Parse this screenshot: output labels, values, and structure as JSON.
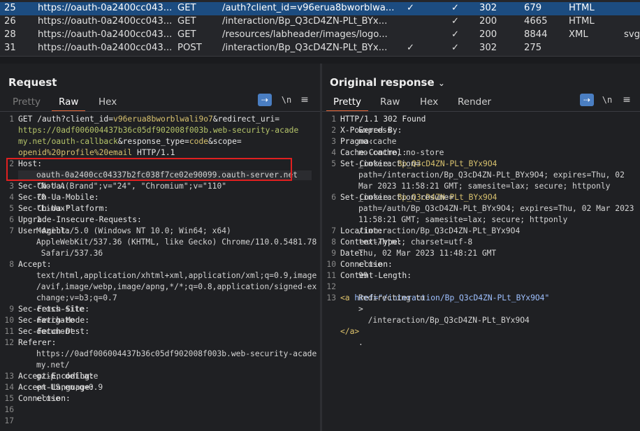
{
  "history": {
    "rows": [
      {
        "num": "25",
        "host": "https://oauth-0a2400cc043...",
        "method": "GET",
        "url": "/auth?client_id=v96erua8bworblwa...",
        "params": "✓",
        "edited": "✓",
        "status": "302",
        "length": "679",
        "mime": "HTML",
        "ext": "",
        "selected": true
      },
      {
        "num": "26",
        "host": "https://oauth-0a2400cc043...",
        "method": "GET",
        "url": "/interaction/Bp_Q3cD4ZN-PLt_BYx...",
        "params": "",
        "edited": "✓",
        "status": "200",
        "length": "4665",
        "mime": "HTML",
        "ext": "",
        "selected": false
      },
      {
        "num": "28",
        "host": "https://oauth-0a2400cc043...",
        "method": "GET",
        "url": "/resources/labheader/images/logo...",
        "params": "",
        "edited": "✓",
        "status": "200",
        "length": "8844",
        "mime": "XML",
        "ext": "svg",
        "selected": false
      },
      {
        "num": "31",
        "host": "https://oauth-0a2400cc043...",
        "method": "POST",
        "url": "/interaction/Bp_Q3cD4ZN-PLt_BYx...",
        "params": "✓",
        "edited": "✓",
        "status": "302",
        "length": "275",
        "mime": "",
        "ext": "",
        "selected": false
      }
    ]
  },
  "request": {
    "title": "Request",
    "tabs": [
      "Pretty",
      "Raw",
      "Hex"
    ],
    "active_tab": "Raw",
    "wrap_icon": "wrap-lines-icon",
    "newline_label": "\\n",
    "menu_icon": "hamburger-menu-icon"
  },
  "response": {
    "title": "Original response",
    "tabs": [
      "Pretty",
      "Raw",
      "Hex",
      "Render"
    ],
    "active_tab": "Pretty",
    "wrap_icon": "wrap-lines-icon",
    "newline_label": "\\n",
    "menu_icon": "hamburger-menu-icon"
  },
  "request_lines": [
    {
      "n": "1",
      "segs": [
        [
          "GET /auth?client_id=",
          "hdr"
        ],
        [
          "v96erua8bworblwali9o7",
          "yel"
        ],
        [
          "&redirect_uri=",
          "hdr"
        ]
      ]
    },
    {
      "n": "",
      "segs": [
        [
          "https://0adf006004437b36c05df902008f003b.web-security-acade",
          "grn"
        ]
      ]
    },
    {
      "n": "",
      "segs": [
        [
          "my.net/oauth-callback",
          "grn"
        ],
        [
          "&response_type=",
          "hdr"
        ],
        [
          "code",
          "yel"
        ],
        [
          "&scope=",
          "hdr"
        ]
      ]
    },
    {
      "n": "",
      "segs": [
        [
          "openid%20profile%20email",
          "yel"
        ],
        [
          " HTTP/1.1",
          "hdr"
        ]
      ]
    },
    {
      "n": "2",
      "segs": [
        [
          "Host:",
          "hdr"
        ]
      ]
    },
    {
      "n": "",
      "segs": [
        [
          "oauth-0a2400cc04337b2fc038f7ce02e90099.oauth-server.net",
          "txt"
        ]
      ]
    },
    {
      "n": "3",
      "segs": [
        [
          "Sec-Ch-Ua: ",
          "hdr"
        ],
        [
          "\"Not A(Brand\";v=\"24\", \"Chromium\";v=\"110\"",
          "txt"
        ]
      ]
    },
    {
      "n": "4",
      "segs": [
        [
          "Sec-Ch-Ua-Mobile: ",
          "hdr"
        ],
        [
          "?0",
          "txt"
        ]
      ]
    },
    {
      "n": "5",
      "segs": [
        [
          "Sec-Ch-Ua-Platform: ",
          "hdr"
        ],
        [
          "\"Linux\"",
          "txt"
        ]
      ]
    },
    {
      "n": "6",
      "segs": [
        [
          "Upgrade-Insecure-Requests: ",
          "hdr"
        ],
        [
          "1",
          "txt"
        ]
      ]
    },
    {
      "n": "7",
      "segs": [
        [
          "User-Agent: ",
          "hdr"
        ],
        [
          "Mozilla/5.0 (Windows NT 10.0; Win64; x64)",
          "txt"
        ]
      ]
    },
    {
      "n": "",
      "segs": [
        [
          "AppleWebKit/537.36 (KHTML, like Gecko) Chrome/110.0.5481.78",
          "txt"
        ]
      ]
    },
    {
      "n": "",
      "segs": [
        [
          " Safari/537.36",
          "txt"
        ]
      ]
    },
    {
      "n": "8",
      "segs": [
        [
          "Accept:",
          "hdr"
        ]
      ]
    },
    {
      "n": "",
      "segs": [
        [
          "text/html,application/xhtml+xml,application/xml;q=0.9,image",
          "txt"
        ]
      ]
    },
    {
      "n": "",
      "segs": [
        [
          "/avif,image/webp,image/apng,*/*;q=0.8,application/signed-ex",
          "txt"
        ]
      ]
    },
    {
      "n": "",
      "segs": [
        [
          "change;v=b3;q=0.7",
          "txt"
        ]
      ]
    },
    {
      "n": "9",
      "segs": [
        [
          "Sec-Fetch-Site: ",
          "hdr"
        ],
        [
          "cross-site",
          "txt"
        ]
      ]
    },
    {
      "n": "10",
      "segs": [
        [
          "Sec-Fetch-Mode: ",
          "hdr"
        ],
        [
          "navigate",
          "txt"
        ]
      ]
    },
    {
      "n": "11",
      "segs": [
        [
          "Sec-Fetch-Dest: ",
          "hdr"
        ],
        [
          "document",
          "txt"
        ]
      ]
    },
    {
      "n": "12",
      "segs": [
        [
          "Referer:",
          "hdr"
        ]
      ]
    },
    {
      "n": "",
      "segs": [
        [
          "https://0adf006004437b36c05df902008f003b.web-security-acade",
          "txt"
        ]
      ]
    },
    {
      "n": "",
      "segs": [
        [
          "my.net/",
          "txt"
        ]
      ]
    },
    {
      "n": "13",
      "segs": [
        [
          "Accept-Encoding: ",
          "hdr"
        ],
        [
          "gzip, deflate",
          "txt"
        ]
      ]
    },
    {
      "n": "14",
      "segs": [
        [
          "Accept-Language: ",
          "hdr"
        ],
        [
          "en-US,en;q=0.9",
          "txt"
        ]
      ]
    },
    {
      "n": "15",
      "segs": [
        [
          "Connection: ",
          "hdr"
        ],
        [
          "close",
          "txt"
        ]
      ]
    },
    {
      "n": "16",
      "segs": []
    },
    {
      "n": "17",
      "segs": []
    }
  ],
  "response_lines": [
    {
      "n": "1",
      "segs": [
        [
          "HTTP/1.1 302 Found",
          "hdr"
        ]
      ]
    },
    {
      "n": "2",
      "segs": [
        [
          "X-Powered-By: ",
          "hdr"
        ],
        [
          "Express",
          "txt"
        ]
      ]
    },
    {
      "n": "3",
      "segs": [
        [
          "Pragma: ",
          "hdr"
        ],
        [
          "no-cache",
          "txt"
        ]
      ]
    },
    {
      "n": "4",
      "segs": [
        [
          "Cache-Control: ",
          "hdr"
        ],
        [
          "no-cache, no-store",
          "txt"
        ]
      ]
    },
    {
      "n": "5",
      "segs": [
        [
          "Set-Cookie: ",
          "hdr"
        ],
        [
          "_interaction=",
          "txt"
        ],
        [
          "Bp_Q3cD4ZN-PLt_BYx9O4",
          "yel"
        ],
        [
          ";",
          "txt"
        ]
      ]
    },
    {
      "n": "",
      "segs": [
        [
          "path=/interaction/Bp_Q3cD4ZN-PLt_BYx9O4; expires=Thu, 02",
          "txt"
        ]
      ]
    },
    {
      "n": "",
      "segs": [
        [
          "Mar 2023 11:58:21 GMT; samesite=lax; secure; httponly",
          "txt"
        ]
      ]
    },
    {
      "n": "6",
      "segs": [
        [
          "Set-Cookie: ",
          "hdr"
        ],
        [
          "_interaction_resume=",
          "txt"
        ],
        [
          "Bp_Q3cD4ZN-PLt_BYx9O4",
          "yel"
        ],
        [
          ";",
          "txt"
        ]
      ]
    },
    {
      "n": "",
      "segs": [
        [
          "path=/auth/Bp_Q3cD4ZN-PLt_BYx9O4; expires=Thu, 02 Mar 2023",
          "txt"
        ]
      ]
    },
    {
      "n": "",
      "segs": [
        [
          "11:58:21 GMT; samesite=lax; secure; httponly",
          "txt"
        ]
      ]
    },
    {
      "n": "7",
      "segs": [
        [
          "Location: ",
          "hdr"
        ],
        [
          "/interaction/Bp_Q3cD4ZN-PLt_BYx9O4",
          "txt"
        ]
      ]
    },
    {
      "n": "8",
      "segs": [
        [
          "Content-Type: ",
          "hdr"
        ],
        [
          "text/html; charset=utf-8",
          "txt"
        ]
      ]
    },
    {
      "n": "9",
      "segs": [
        [
          "Date: ",
          "hdr"
        ],
        [
          "Thu, 02 Mar 2023 11:48:21 GMT",
          "txt"
        ]
      ]
    },
    {
      "n": "10",
      "segs": [
        [
          "Connection: ",
          "hdr"
        ],
        [
          "close",
          "txt"
        ]
      ]
    },
    {
      "n": "11",
      "segs": [
        [
          "Content-Length: ",
          "hdr"
        ],
        [
          "99",
          "txt"
        ]
      ]
    },
    {
      "n": "12",
      "segs": []
    },
    {
      "n": "13",
      "segs": [
        [
          "Redirecting to ",
          "txt"
        ],
        [
          "<a ",
          "tag"
        ],
        [
          "href=",
          "blu"
        ],
        [
          "\"/interaction/Bp_Q3cD4ZN-PLt_BYx9O4\"",
          "blu"
        ]
      ]
    },
    {
      "n": "",
      "segs": [
        [
          ">",
          "txt"
        ]
      ]
    },
    {
      "n": "",
      "segs": [
        [
          "  /interaction/Bp_Q3cD4ZN-PLt_BYx9O4",
          "txt"
        ]
      ]
    },
    {
      "n": "",
      "segs": [
        [
          "</a>",
          "tag"
        ]
      ]
    },
    {
      "n": "",
      "segs": [
        [
          ".",
          "txt"
        ]
      ]
    }
  ],
  "colors": {
    "accent": "#e8693a",
    "selected_row": "#1c4c80",
    "highlight_box": "#e02020",
    "toggle_on": "#4a7ec2"
  }
}
